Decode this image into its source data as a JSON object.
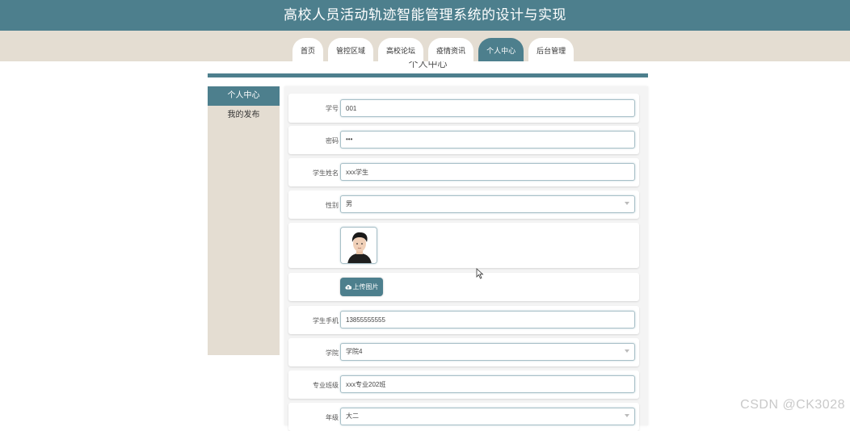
{
  "header": {
    "title": "高校人员活动轨迹智能管理系统的设计与实现"
  },
  "nav": {
    "tabs": [
      "首页",
      "管控区域",
      "高校论坛",
      "疫情资讯",
      "个人中心",
      "后台管理"
    ],
    "active_index": 4
  },
  "breadcrumb": {
    "text": "个人中心"
  },
  "sidebar": {
    "items": [
      {
        "label": "个人中心",
        "active": true
      },
      {
        "label": "我的发布",
        "active": false
      }
    ]
  },
  "form": {
    "student_id": {
      "label": "学号",
      "value": "001"
    },
    "password": {
      "label": "密码",
      "value": "•••"
    },
    "student_name": {
      "label": "学生姓名",
      "value": "xxx学生"
    },
    "gender": {
      "label": "性别",
      "value": "男"
    },
    "upload": {
      "label": "上传图片"
    },
    "phone": {
      "label": "学生手机",
      "value": "13855555555"
    },
    "college": {
      "label": "学院",
      "value": "学院4"
    },
    "class": {
      "label": "专业班级",
      "value": "xxx专业202班"
    },
    "grade": {
      "label": "年级",
      "value": "大二"
    }
  },
  "watermark": "CSDN @CK3028",
  "colors": {
    "primary": "#4d7f8d",
    "beige": "#e4ddd2"
  }
}
